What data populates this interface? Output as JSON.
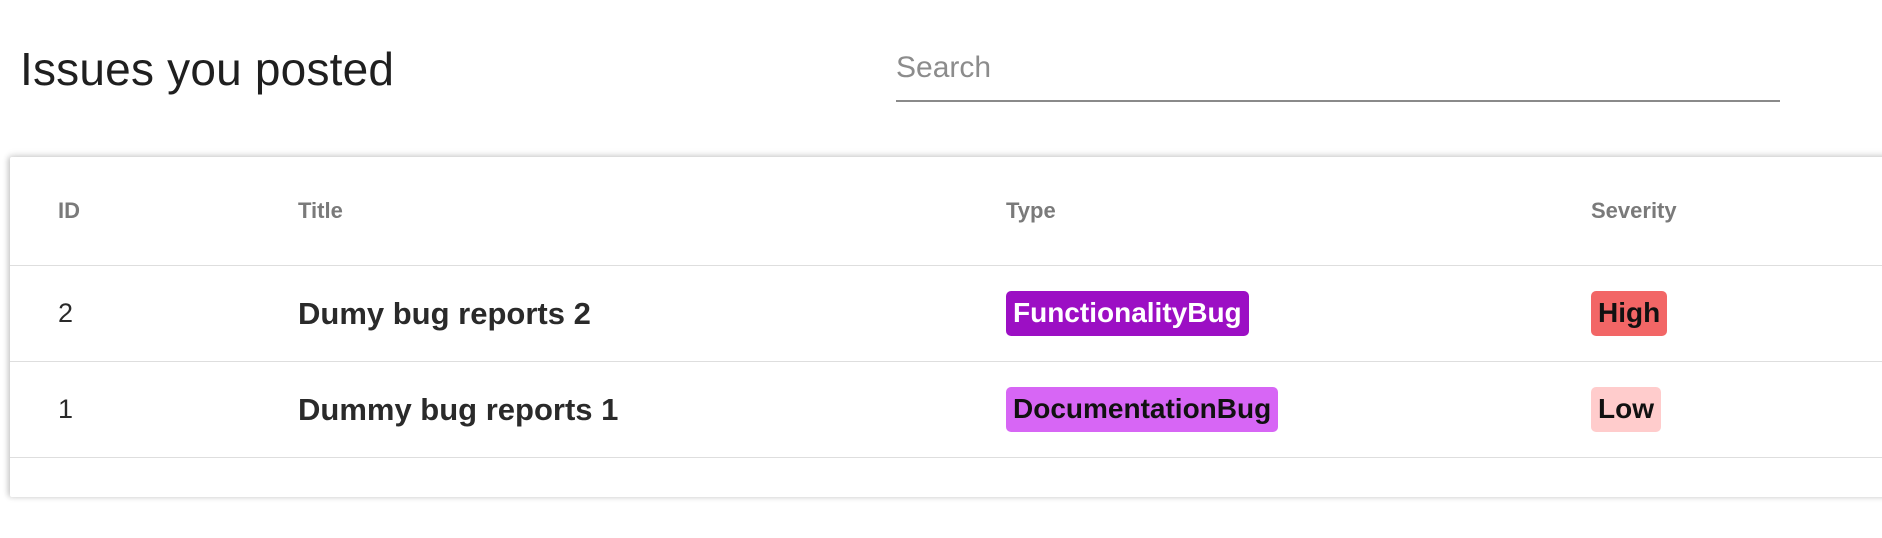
{
  "header": {
    "title": "Issues you posted",
    "search_placeholder": "Search",
    "search_value": ""
  },
  "table": {
    "columns": {
      "id": "ID",
      "title": "Title",
      "type": "Type",
      "severity": "Severity"
    },
    "rows": [
      {
        "id": "2",
        "title": "Dumy bug reports 2",
        "type": "FunctionalityBug",
        "severity": "High"
      },
      {
        "id": "1",
        "title": "Dummy bug reports 1",
        "type": "DocumentationBug",
        "severity": "Low"
      }
    ]
  },
  "badge_colors": {
    "FunctionalityBug": {
      "bg": "#9c0fc4",
      "fg": "#ffffff"
    },
    "DocumentationBug": {
      "bg": "#d766f5",
      "fg": "#111111"
    },
    "High": {
      "bg": "#f26666",
      "fg": "#111111"
    },
    "Low": {
      "bg": "#ffcccc",
      "fg": "#111111"
    }
  }
}
